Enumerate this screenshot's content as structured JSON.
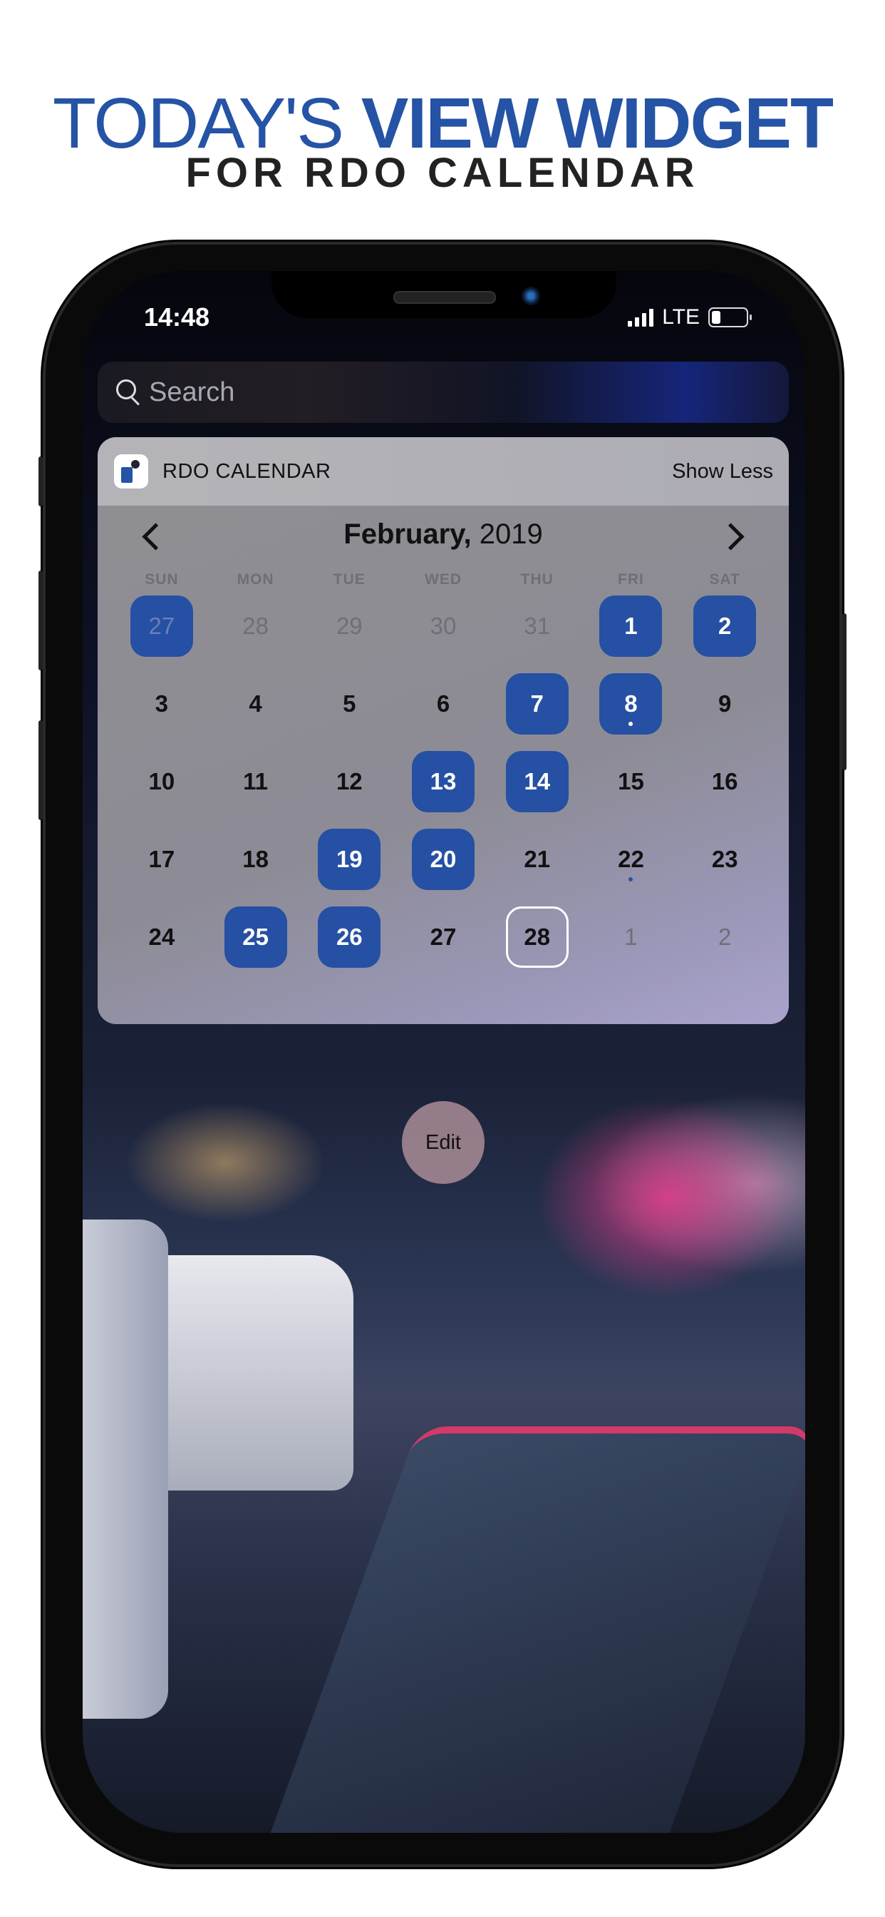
{
  "promo": {
    "title_light": "TODAY'S",
    "title_bold": "VIEW WIDGET",
    "subtitle": "FOR RDO CALENDAR"
  },
  "status_bar": {
    "time": "14:48",
    "network": "LTE",
    "icons": [
      "signal-icon",
      "battery-icon"
    ]
  },
  "search": {
    "placeholder": "Search"
  },
  "widget": {
    "app_name": "RDO CALENDAR",
    "show_less": "Show Less",
    "month_name": "February,",
    "year": "2019",
    "weekdays": [
      "SUN",
      "MON",
      "TUE",
      "WED",
      "THU",
      "FRI",
      "SAT"
    ],
    "weeks": [
      [
        {
          "d": "27",
          "other": true,
          "rdo": true
        },
        {
          "d": "28",
          "other": true
        },
        {
          "d": "29",
          "other": true
        },
        {
          "d": "30",
          "other": true
        },
        {
          "d": "31",
          "other": true
        },
        {
          "d": "1",
          "rdo": true
        },
        {
          "d": "2",
          "rdo": true
        }
      ],
      [
        {
          "d": "3"
        },
        {
          "d": "4"
        },
        {
          "d": "5"
        },
        {
          "d": "6"
        },
        {
          "d": "7",
          "rdo": true
        },
        {
          "d": "8",
          "rdo": true,
          "dot": true
        },
        {
          "d": "9"
        }
      ],
      [
        {
          "d": "10"
        },
        {
          "d": "11"
        },
        {
          "d": "12"
        },
        {
          "d": "13",
          "rdo": true
        },
        {
          "d": "14",
          "rdo": true
        },
        {
          "d": "15"
        },
        {
          "d": "16"
        }
      ],
      [
        {
          "d": "17"
        },
        {
          "d": "18"
        },
        {
          "d": "19",
          "rdo": true
        },
        {
          "d": "20",
          "rdo": true
        },
        {
          "d": "21"
        },
        {
          "d": "22",
          "dot": true
        },
        {
          "d": "23"
        }
      ],
      [
        {
          "d": "24"
        },
        {
          "d": "25",
          "rdo": true
        },
        {
          "d": "26",
          "rdo": true
        },
        {
          "d": "27"
        },
        {
          "d": "28",
          "today": true
        },
        {
          "d": "1",
          "other": true
        },
        {
          "d": "2",
          "other": true
        }
      ]
    ],
    "colors": {
      "rdo": "#2550a3",
      "accent": "#2553a5"
    }
  },
  "edit_button": {
    "label": "Edit"
  }
}
